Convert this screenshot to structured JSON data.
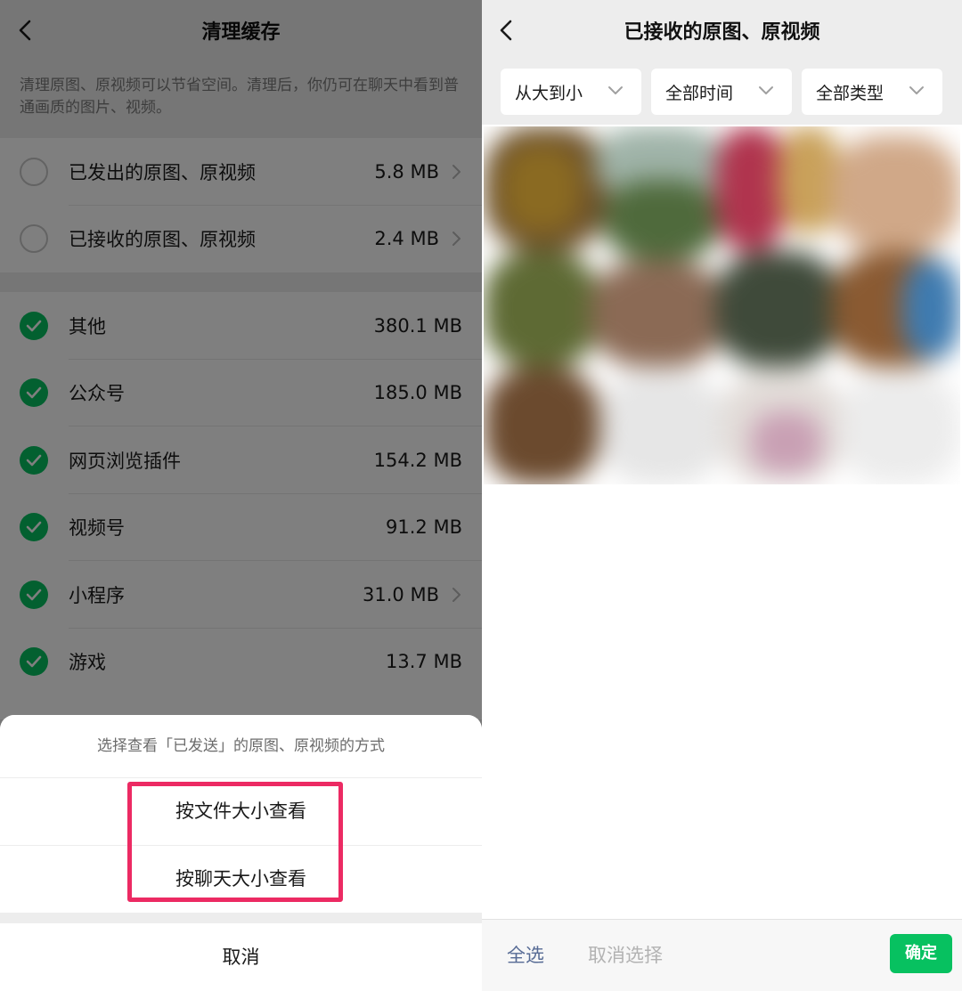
{
  "left": {
    "title": "清理缓存",
    "description": "清理原图、原视频可以节省空间。清理后，你仍可在聊天中看到普通画质的图片、视频。",
    "group1": [
      {
        "label": "已发出的原图、原视频",
        "size": "5.8 MB",
        "checked": false,
        "arrow": true
      },
      {
        "label": "已接收的原图、原视频",
        "size": "2.4 MB",
        "checked": false,
        "arrow": true
      }
    ],
    "group2": [
      {
        "label": "其他",
        "size": "380.1 MB",
        "checked": true,
        "arrow": false
      },
      {
        "label": "公众号",
        "size": "185.0 MB",
        "checked": true,
        "arrow": false
      },
      {
        "label": "网页浏览插件",
        "size": "154.2 MB",
        "checked": true,
        "arrow": false
      },
      {
        "label": "视频号",
        "size": "91.2 MB",
        "checked": true,
        "arrow": false
      },
      {
        "label": "小程序",
        "size": "31.0 MB",
        "checked": true,
        "arrow": true
      },
      {
        "label": "游戏",
        "size": "13.7 MB",
        "checked": true,
        "arrow": false
      }
    ],
    "sheet": {
      "title": "选择查看「已发送」的原图、原视频的方式",
      "option1": "按文件大小查看",
      "option2": "按聊天大小查看",
      "cancel": "取消"
    }
  },
  "right": {
    "title": "已接收的原图、原视频",
    "filters": [
      {
        "label": "从大到小"
      },
      {
        "label": "全部时间"
      },
      {
        "label": "全部类型"
      }
    ],
    "footer": {
      "select_all": "全选",
      "deselect": "取消选择",
      "confirm": "确定"
    }
  },
  "colors": {
    "accent_green": "#07c160",
    "link_blue": "#576b95",
    "highlight_pink": "#ec2a63",
    "panel_gray": "#ededed"
  },
  "icons": {
    "back": "chevron-left-icon",
    "row_arrow": "chevron-right-icon",
    "filter_arrow": "chevron-down-icon",
    "checked": "checkmark-circle-icon",
    "unchecked": "empty-radio-icon"
  }
}
